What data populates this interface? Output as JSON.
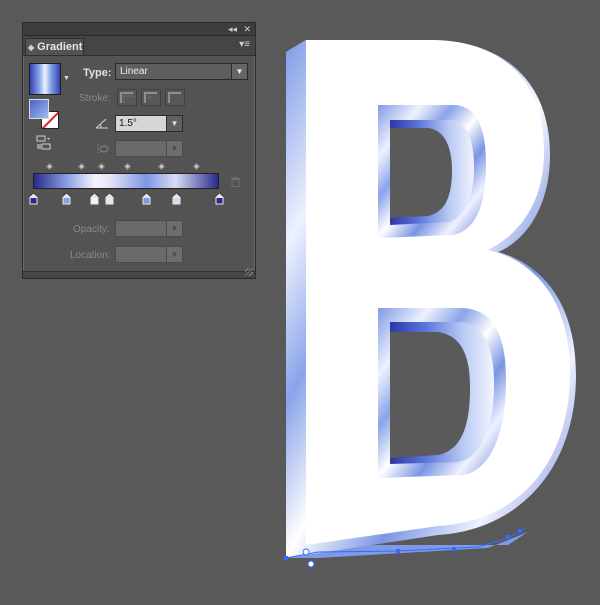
{
  "panel": {
    "title": "Gradient",
    "controls": {
      "collapse": "◂◂",
      "close": "✕",
      "menu": "▾≡"
    },
    "type_label": "Type:",
    "type_value": "Linear",
    "stroke_label": "Stroke:",
    "angle_value": "1.5°",
    "opacity_label": "Opacity:",
    "location_label": "Location:",
    "icons": {
      "angle": "angle-icon",
      "aspect": "aspect-ratio-icon",
      "reverse": "reverse-gradient-icon",
      "delete": "trash-icon"
    },
    "gradient_stops": [
      {
        "position": 0.0,
        "color": "#2a2a8c"
      },
      {
        "position": 0.18,
        "color": "#8aa0e6"
      },
      {
        "position": 0.33,
        "color": "#f4f2ff"
      },
      {
        "position": 0.41,
        "color": "#e8e4f6"
      },
      {
        "position": 0.61,
        "color": "#7f96e4"
      },
      {
        "position": 0.77,
        "color": "#d8dcf4"
      },
      {
        "position": 1.0,
        "color": "#2a2a8c"
      }
    ],
    "midpoints": [
      0.09,
      0.26,
      0.37,
      0.51,
      0.69,
      0.88
    ]
  },
  "canvas": {
    "letter": "B",
    "face_color": "#ffffff",
    "extrusion_colors": [
      "#3b43b8",
      "#7c93e2",
      "#eef0ff",
      "#9aa3d8",
      "#6a68b0"
    ],
    "selection_color": "#2f6cff"
  }
}
